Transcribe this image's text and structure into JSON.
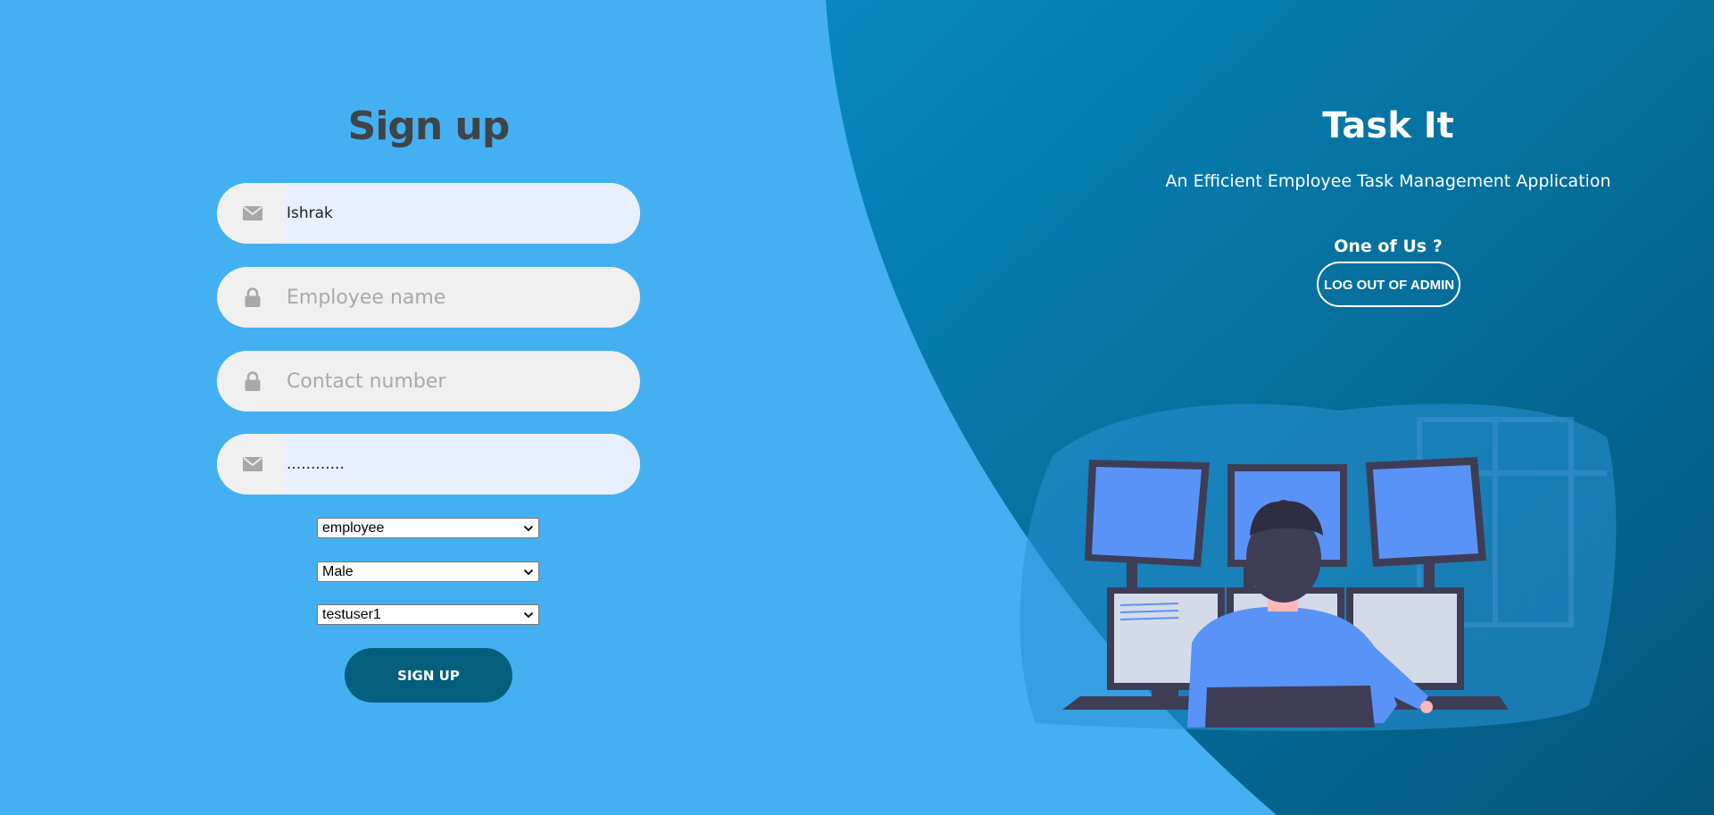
{
  "signup": {
    "title": "Sign up",
    "username_value": "Ishrak",
    "employee_name_placeholder": "Employee name",
    "contact_placeholder": "Contact number",
    "password_value": "............",
    "role_selected": "employee",
    "gender_selected": "Male",
    "manager_selected": "testuser1",
    "submit_label": "SIGN UP"
  },
  "brand": {
    "title": "Task It",
    "tagline": "An Efficient Employee Task Management Application",
    "prompt": "One of Us ?",
    "logout_label": "LOG OUT OF ADMIN"
  },
  "icons": {
    "username": "envelope-icon",
    "employee_name": "lock-icon",
    "contact": "lock-icon",
    "password": "envelope-icon",
    "select_arrow": "chevron-down-icon"
  },
  "colors": {
    "left_bg": "#44b0f2",
    "right_bg": "#05668d",
    "input_bg": "#f0f0f0",
    "autofill_bg": "#e8f0fe",
    "button_bg": "#045f7d",
    "title_text": "#3e4447",
    "placeholder_text": "#a9a9a9",
    "monitor_screen": "#5a93f8"
  }
}
